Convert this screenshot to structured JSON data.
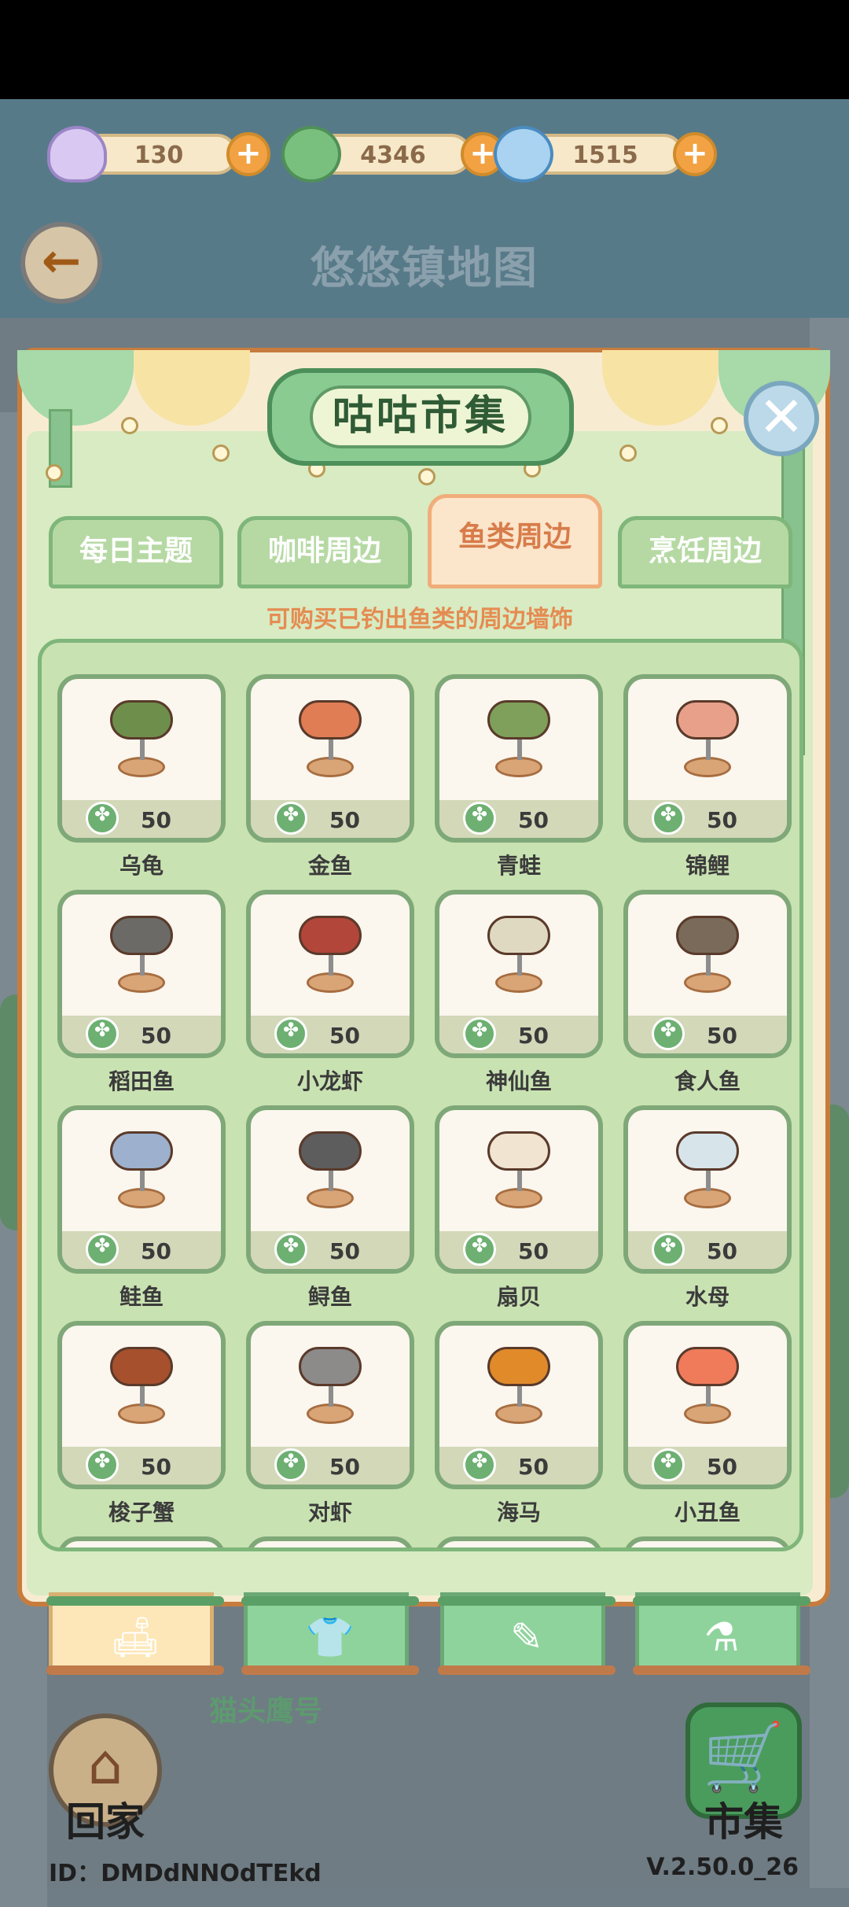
{
  "currency": [
    {
      "name": "shell",
      "value": "130"
    },
    {
      "name": "clover",
      "value": "4346"
    },
    {
      "name": "swirl",
      "value": "1515"
    }
  ],
  "header": {
    "map_title": "悠悠镇地图"
  },
  "panel": {
    "title": "咕咕市集",
    "tabs": [
      "每日主题",
      "咖啡周边",
      "鱼类周边",
      "烹饪周边"
    ],
    "active_tab": 2,
    "subtitle": "可购买已钓出鱼类的周边墙饰"
  },
  "items": [
    {
      "name": "乌龟",
      "price": "50",
      "color": "#6e8f4c"
    },
    {
      "name": "金鱼",
      "price": "50",
      "color": "#e07d55"
    },
    {
      "name": "青蛙",
      "price": "50",
      "color": "#7ea05a"
    },
    {
      "name": "锦鲤",
      "price": "50",
      "color": "#e8a08a"
    },
    {
      "name": "稻田鱼",
      "price": "50",
      "color": "#6b6a66"
    },
    {
      "name": "小龙虾",
      "price": "50",
      "color": "#b3463a"
    },
    {
      "name": "神仙鱼",
      "price": "50",
      "color": "#e0d9c2"
    },
    {
      "name": "食人鱼",
      "price": "50",
      "color": "#7a6a5a"
    },
    {
      "name": "鲑鱼",
      "price": "50",
      "color": "#9db1cf"
    },
    {
      "name": "鲟鱼",
      "price": "50",
      "color": "#5d5d5d"
    },
    {
      "name": "扇贝",
      "price": "50",
      "color": "#f1e4d0"
    },
    {
      "name": "水母",
      "price": "50",
      "color": "#d7e5ea"
    },
    {
      "name": "梭子蟹",
      "price": "50",
      "color": "#a6502e"
    },
    {
      "name": "对虾",
      "price": "50",
      "color": "#8d8a8a"
    },
    {
      "name": "海马",
      "price": "50",
      "color": "#e08a2a"
    },
    {
      "name": "小丑鱼",
      "price": "50",
      "color": "#f07b5b"
    }
  ],
  "bottom_tabs": [
    {
      "icon": "sofa-icon",
      "label": "sofa"
    },
    {
      "icon": "shirt-icon",
      "label": "shirt"
    },
    {
      "icon": "notepad-icon",
      "label": "notepad"
    },
    {
      "icon": "bottle-icon",
      "label": "bottle"
    }
  ],
  "owl_label": "猫头鹰号",
  "home_label": "回家",
  "shop_label": "市集",
  "id_text": "ID：DMDdNNOdTEkd",
  "version": "V.2.50.0_26"
}
